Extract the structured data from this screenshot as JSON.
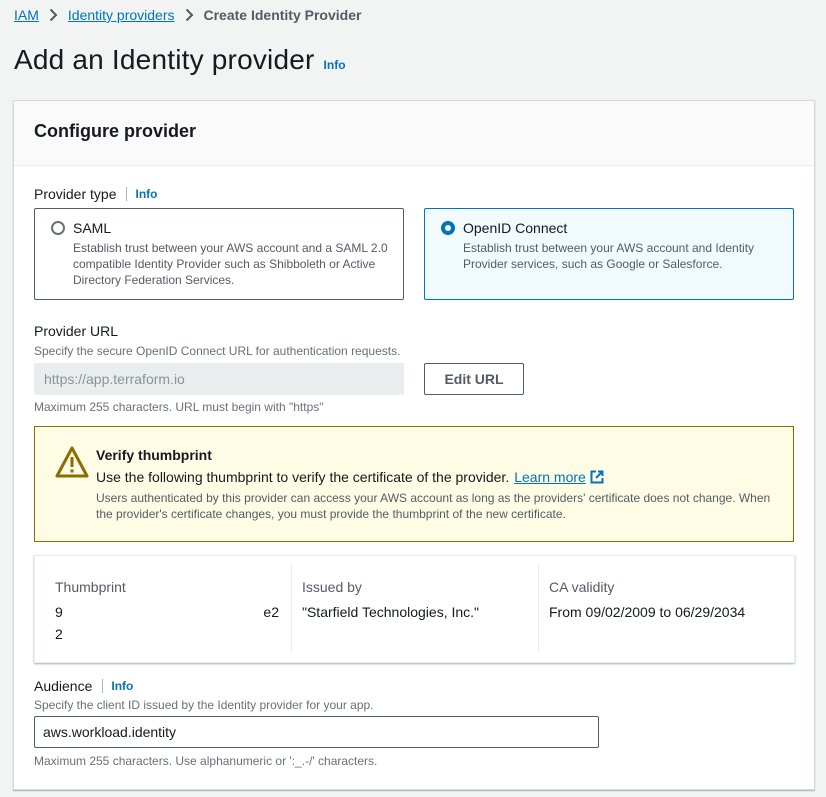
{
  "breadcrumb": {
    "items": [
      "IAM",
      "Identity providers"
    ],
    "current": "Create Identity Provider"
  },
  "page": {
    "title": "Add an Identity provider",
    "info": "Info"
  },
  "panel": {
    "title": "Configure provider"
  },
  "provider_type": {
    "label": "Provider type",
    "info": "Info",
    "options": [
      {
        "title": "SAML",
        "desc": "Establish trust between your AWS account and a SAML 2.0 compatible Identity Provider such as Shibboleth or Active Directory Federation Services.",
        "selected": false
      },
      {
        "title": "OpenID Connect",
        "desc": "Establish trust between your AWS account and Identity Provider services, such as Google or Salesforce.",
        "selected": true
      }
    ]
  },
  "provider_url": {
    "label": "Provider URL",
    "desc": "Specify the secure OpenID Connect URL for authentication requests.",
    "value": "https://app.terraform.io",
    "edit_button": "Edit URL",
    "constraint": "Maximum 255 characters. URL must begin with \"https\""
  },
  "alert": {
    "title": "Verify thumbprint",
    "text": "Use the following thumbprint to verify the certificate of the provider.",
    "link": "Learn more",
    "detail": "Users authenticated by this provider can access your AWS account as long as the providers' certificate does not change. When the provider's certificate changes, you must provide the thumbprint of the new certificate."
  },
  "thumbprint_table": {
    "columns": [
      "Thumbprint",
      "Issued by",
      "CA validity"
    ],
    "thumbprint_line1_start": "9",
    "thumbprint_line1_end": "e2",
    "thumbprint_line2": "2",
    "issued_by": "\"Starfield Technologies, Inc.\"",
    "ca_validity": "From 09/02/2009 to 06/29/2034"
  },
  "audience": {
    "label": "Audience",
    "info": "Info",
    "desc": "Specify the client ID issued by the Identity provider for your app.",
    "value": "aws.workload.identity",
    "constraint": "Maximum 255 characters. Use alphanumeric or ':_.-/' characters."
  },
  "colors": {
    "link": "#0073bb",
    "selected_bg": "#f1faff",
    "warning_bg": "#fffce6",
    "warning_border": "#8c6c00"
  }
}
